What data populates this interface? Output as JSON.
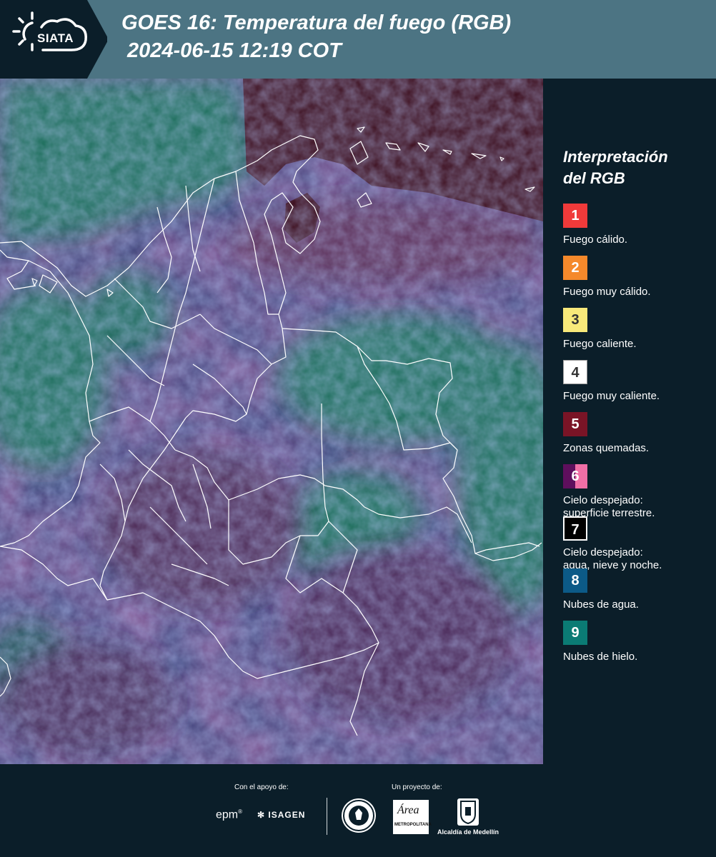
{
  "header": {
    "logo_text": "SIATA",
    "title": "GOES 16: Temperatura del fuego (RGB)",
    "subtitle": "2024-06-15 12:19 COT"
  },
  "legend": {
    "title_line1": "Interpretación",
    "title_line2": "del RGB",
    "items": [
      {
        "num": "1",
        "label": "Fuego cálido.",
        "color": "#f03a3a",
        "text_color": "#ffffff"
      },
      {
        "num": "2",
        "label": "Fuego muy cálido.",
        "color": "#f5892b",
        "text_color": "#ffffff"
      },
      {
        "num": "3",
        "label": "Fuego caliente.",
        "color": "#f8e97a",
        "text_color": "#333333"
      },
      {
        "num": "4",
        "label": "Fuego muy caliente.",
        "color": "#ffffff",
        "text_color": "#333333"
      },
      {
        "num": "5",
        "label": "Zonas quemadas.",
        "color": "#7a1426",
        "text_color": "#ffffff"
      },
      {
        "num": "6",
        "label_line1": "Cielo despejado:",
        "label_line2": "superficie terrestre.",
        "color": "#5e0f5d",
        "color2": "#f06fa6",
        "text_color": "#ffffff"
      },
      {
        "num": "7",
        "label_line1": "Cielo despejado:",
        "label_line2": "agua, nieve y noche.",
        "color": "#000000",
        "text_color": "#ffffff"
      },
      {
        "num": "8",
        "label": "Nubes de agua.",
        "color": "#0c5a87",
        "text_color": "#ffffff"
      },
      {
        "num": "9",
        "label": "Nubes de hielo.",
        "color": "#0b7b74",
        "text_color": "#ffffff"
      }
    ]
  },
  "footer": {
    "support_label": "Con el apoyo de:",
    "project_label": "Un proyecto de:",
    "epm": "epm",
    "isagen": "ISAGEN",
    "area_name": "Área",
    "area_sub": "METROPOLITANA",
    "alcaldia": "Alcaldía de Medellín"
  },
  "map_colors": {
    "land": "#2d3e74",
    "ice_clouds": "#1c6e5a",
    "clear_land": "#5a2a4e",
    "night_water": "#3a0a18",
    "borders": "#ffffff"
  }
}
